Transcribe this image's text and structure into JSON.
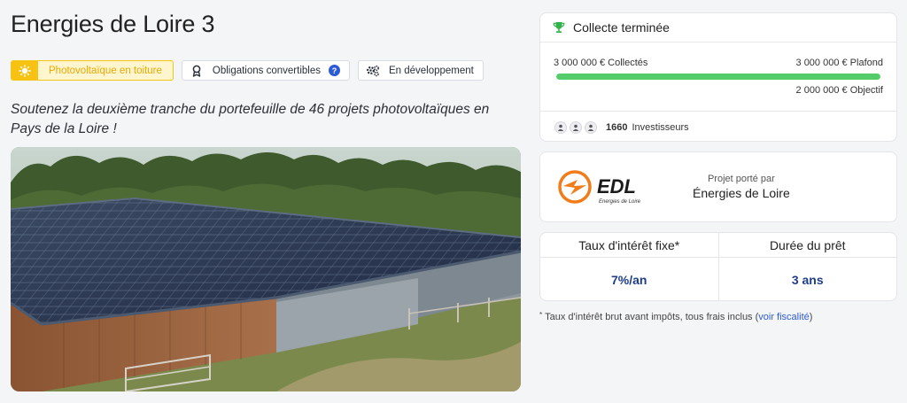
{
  "project": {
    "title": "Energies de Loire 3",
    "subtitle": "Soutenez la deuxième tranche du portefeuille de 46 projets photovoltaïques en Pays de la Loire !",
    "tags": {
      "solar": "Photovoltaïque en toiture",
      "bonds": "Obligations convertibles",
      "stage": "En développement"
    }
  },
  "collect": {
    "status": "Collecte terminée",
    "collected": "3 000 000 € Collectés",
    "ceiling": "3 000 000 € Plafond",
    "objective": "2 000 000 € Objectif",
    "progress_percent": 100,
    "investors_count": "1660",
    "investors_label": "Investisseurs"
  },
  "porteur": {
    "logo_text": "EDL",
    "logo_subtext": "Energies de Loire",
    "label": "Projet porté par",
    "name": "Énergies de Loire"
  },
  "rates": {
    "interest_header": "Taux d'intérêt fixe*",
    "interest_value": "7%/an",
    "duration_header": "Durée du prêt",
    "duration_value": "3 ans"
  },
  "footnote": {
    "star": "*",
    "text": "Taux d'intérêt brut avant impôts, tous frais inclus (",
    "link": "voir fiscalité",
    "close": ")"
  },
  "colors": {
    "accent_blue": "#2d5bd7",
    "progress_green": "#55cc6a",
    "solar_yellow": "#f7c211",
    "trophy_green": "#2fb34a",
    "logo_orange": "#f07c1a"
  },
  "icons": {
    "solar": "sun-icon",
    "bonds": "ribbon-icon",
    "stage": "gears-icon",
    "help": "question-icon",
    "status": "trophy-icon"
  }
}
